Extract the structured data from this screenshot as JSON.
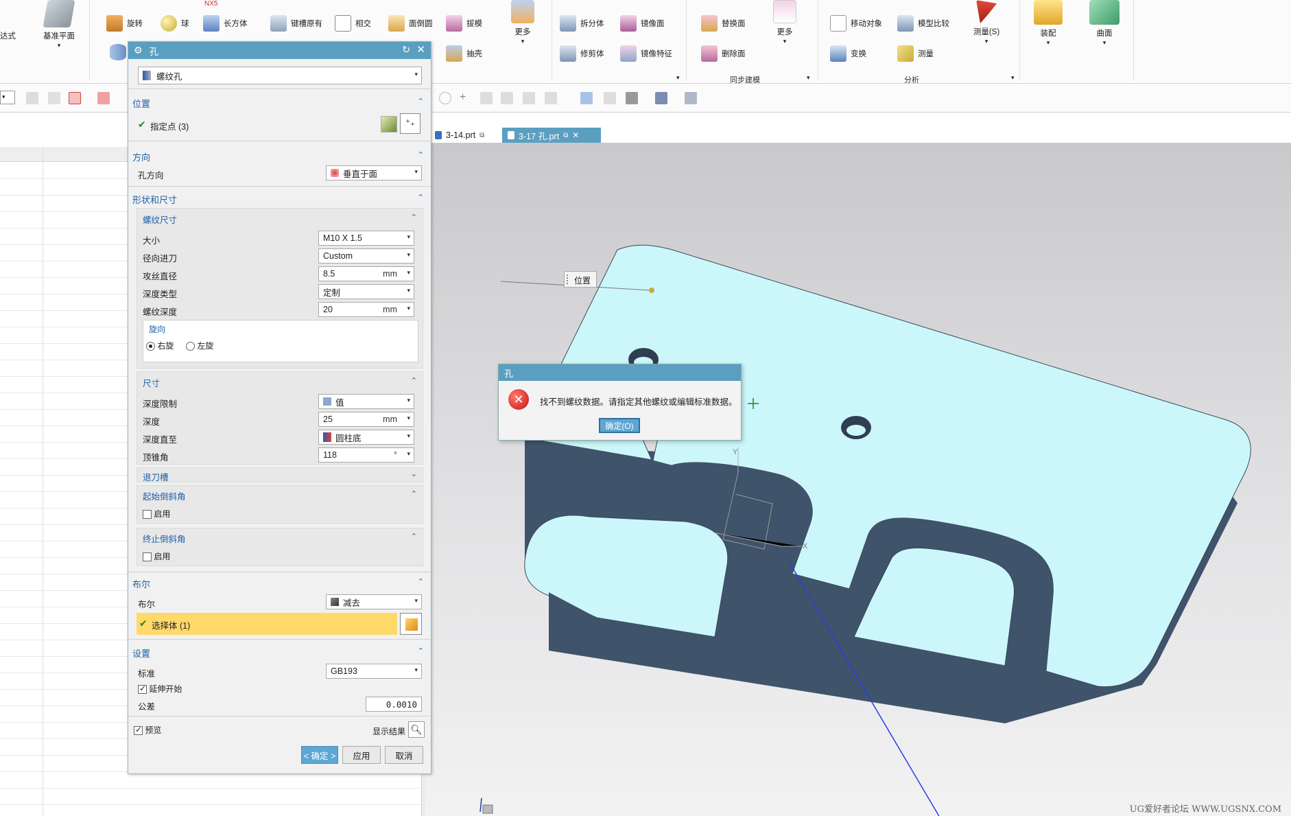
{
  "ribbon": {
    "left_partial_label": "达式",
    "datum_plane": "基准平面",
    "nx5_label": "NX5",
    "revolve": "旋转",
    "sphere": "球",
    "block": "长方体",
    "keyslot": "键槽原有",
    "intersect": "相交",
    "face_blend": "面倒圆",
    "draft": "拔模",
    "more1": "更多",
    "split_body": "拆分体",
    "mirror_body": "镜像面",
    "trim_body": "修剪体",
    "mirror_feature": "镜像特征",
    "shell": "抽壳",
    "replace_face": "替换面",
    "delete_face": "删除面",
    "more2": "更多",
    "sync_group": "同步建模",
    "move_object": "移动对象",
    "model_compare": "模型比较",
    "transform": "变换",
    "measure_small": "测量",
    "measure_big": "测量(S)",
    "analysis_group": "分析",
    "assembly": "装配",
    "surface": "曲面"
  },
  "tabs": [
    {
      "label": "3-14.prt"
    },
    {
      "label": "3-17 孔.prt"
    }
  ],
  "dialog": {
    "title": "孔",
    "type_value": "螺纹孔",
    "position": {
      "header": "位置",
      "specify_point": "指定点 (3)"
    },
    "direction": {
      "header": "方向",
      "label": "孔方向",
      "value": "垂直于面"
    },
    "shape": {
      "header": "形状和尺寸",
      "thread": {
        "header": "螺纹尺寸",
        "size_label": "大小",
        "size_value": "M10 X 1.5",
        "radial_label": "径向进刀",
        "radial_value": "Custom",
        "tap_label": "攻丝直径",
        "tap_value": "8.5",
        "tap_unit": "mm",
        "depth_type_label": "深度类型",
        "depth_type_value": "定制",
        "thread_depth_label": "螺纹深度",
        "thread_depth_value": "20",
        "thread_depth_unit": "mm",
        "hand_header": "旋向",
        "right_hand": "右旋",
        "left_hand": "左旋"
      },
      "dims": {
        "header": "尺寸",
        "depth_limit_label": "深度限制",
        "depth_limit_value": "值",
        "depth_label": "深度",
        "depth_value": "25",
        "depth_unit": "mm",
        "depth_to_label": "深度直至",
        "depth_to_value": "圆柱底",
        "tip_angle_label": "顶锥角",
        "tip_angle_value": "118",
        "tip_angle_unit": "°"
      },
      "relief": "退刀槽",
      "start_chamfer": {
        "header": "起始倒斜角",
        "enable": "启用"
      },
      "end_chamfer": {
        "header": "终止倒斜角",
        "enable": "启用"
      }
    },
    "boolean": {
      "header": "布尔",
      "label": "布尔",
      "value": "减去",
      "select_body": "选择体 (1)"
    },
    "settings": {
      "header": "设置",
      "standard_label": "标准",
      "standard_value": "GB193",
      "extend_start": "延伸开始",
      "tolerance_label": "公差",
      "tolerance_value": "0.0010"
    },
    "preview": "预览",
    "show_result": "显示结果",
    "ok": "< 确定 >",
    "apply": "应用",
    "cancel": "取消"
  },
  "error_dialog": {
    "title": "孔",
    "message": "找不到螺纹数据。请指定其他螺纹或编辑标准数据。",
    "ok": "确定(O)"
  },
  "viewport": {
    "position_tag": "位置",
    "axis_y": "Y",
    "axis_x": "X"
  },
  "watermark": "UG爱好者论坛 WWW.UGSNX.COM",
  "colors": {
    "title_bar": "#5b9fc0",
    "section_header": "#1f5fa5",
    "top_face": "#ccf7fa",
    "side_face": "#3f536b",
    "selection_highlight": "#ffd96a"
  }
}
